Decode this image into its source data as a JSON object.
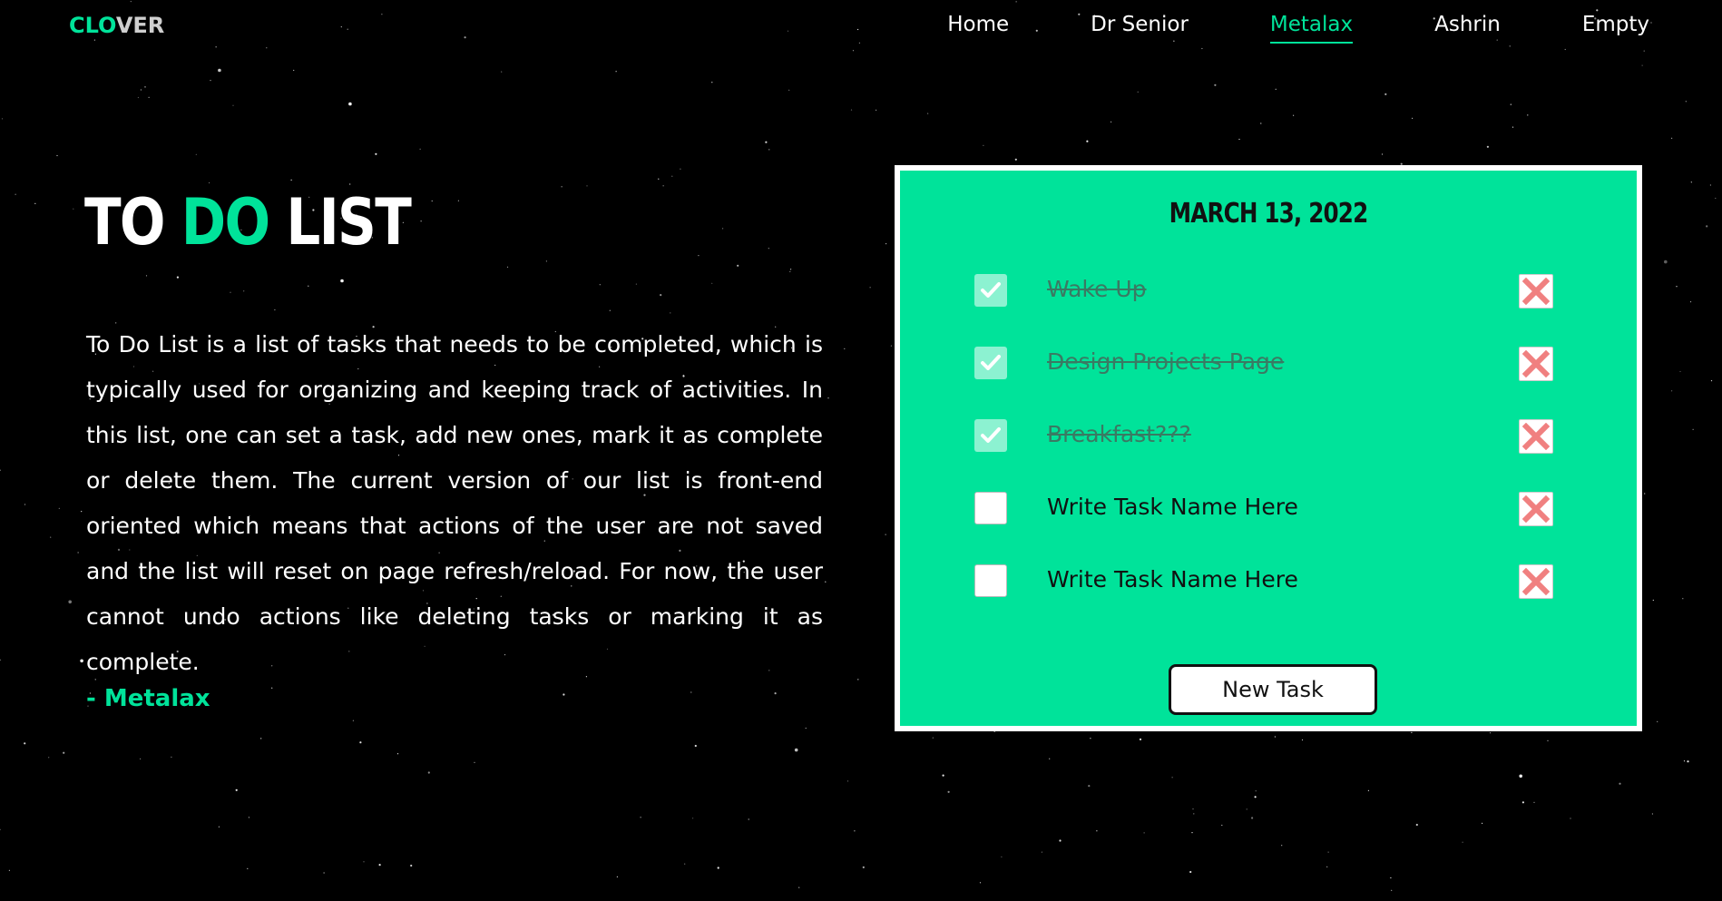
{
  "brand": {
    "logo_part1": "CLO",
    "logo_part2": "VER",
    "accent_color": "#00e39a"
  },
  "nav": {
    "items": [
      {
        "label": "Home",
        "active": false
      },
      {
        "label": "Dr Senior",
        "active": false
      },
      {
        "label": "Metalax",
        "active": true
      },
      {
        "label": "Ashrin",
        "active": false
      },
      {
        "label": "Empty",
        "active": false
      }
    ]
  },
  "hero": {
    "title_part1": "TO ",
    "title_part2": "DO",
    "title_part3": " LIST",
    "description": "To Do List is a list of tasks that needs to be completed, which is typically used for organizing and keeping track of activities. In this list, one can set a task, add new ones, mark it as complete or delete them. The current version of our list is front-end oriented which means that actions of the user are not saved and the list will reset on page refresh/reload. For now, the user cannot undo actions like deleting tasks or marking it as complete.",
    "author": "- Metalax"
  },
  "todo": {
    "date": "MARCH 13, 2022",
    "tasks": [
      {
        "name": "Wake Up",
        "done": true
      },
      {
        "name": "Design Projects Page",
        "done": true
      },
      {
        "name": "Breakfast???",
        "done": true
      },
      {
        "name": "Write Task Name Here",
        "done": false
      },
      {
        "name": "Write Task Name Here",
        "done": false
      }
    ],
    "new_task_label": "New Task",
    "card_color": "#00e39a",
    "delete_icon_color": "#f08080"
  }
}
